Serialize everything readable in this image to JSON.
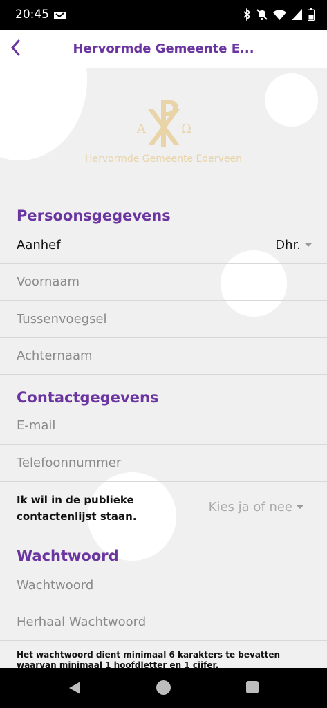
{
  "status_bar": {
    "time": "20:45"
  },
  "appbar": {
    "title": "Hervormde Gemeente E..."
  },
  "logo": {
    "text": "Hervormde Gemeente Ederveen"
  },
  "personal": {
    "title": "Persoonsgegevens",
    "salutation_label": "Aanhef",
    "salutation_value": "Dhr.",
    "first_name_placeholder": "Voornaam",
    "infix_placeholder": "Tussenvoegsel",
    "last_name_placeholder": "Achternaam"
  },
  "contact": {
    "title": "Contactgegevens",
    "email_placeholder": "E-mail",
    "phone_placeholder": "Telefoonnummer",
    "public_list_label": "Ik wil in de publieke contactenlijst staan.",
    "public_list_select": "Kies ja of nee"
  },
  "password": {
    "title": "Wachtwoord",
    "password_placeholder": "Wachtwoord",
    "repeat_placeholder": "Herhaal Wachtwoord",
    "note": "Het wachtwoord dient minimaal 6 karakters te bevatten waarvan minimaal 1 hoofdletter en 1 cijfer."
  },
  "colors": {
    "accent": "#6a35a0",
    "logo": "#e9d4a8",
    "background": "#f0f0f0"
  }
}
